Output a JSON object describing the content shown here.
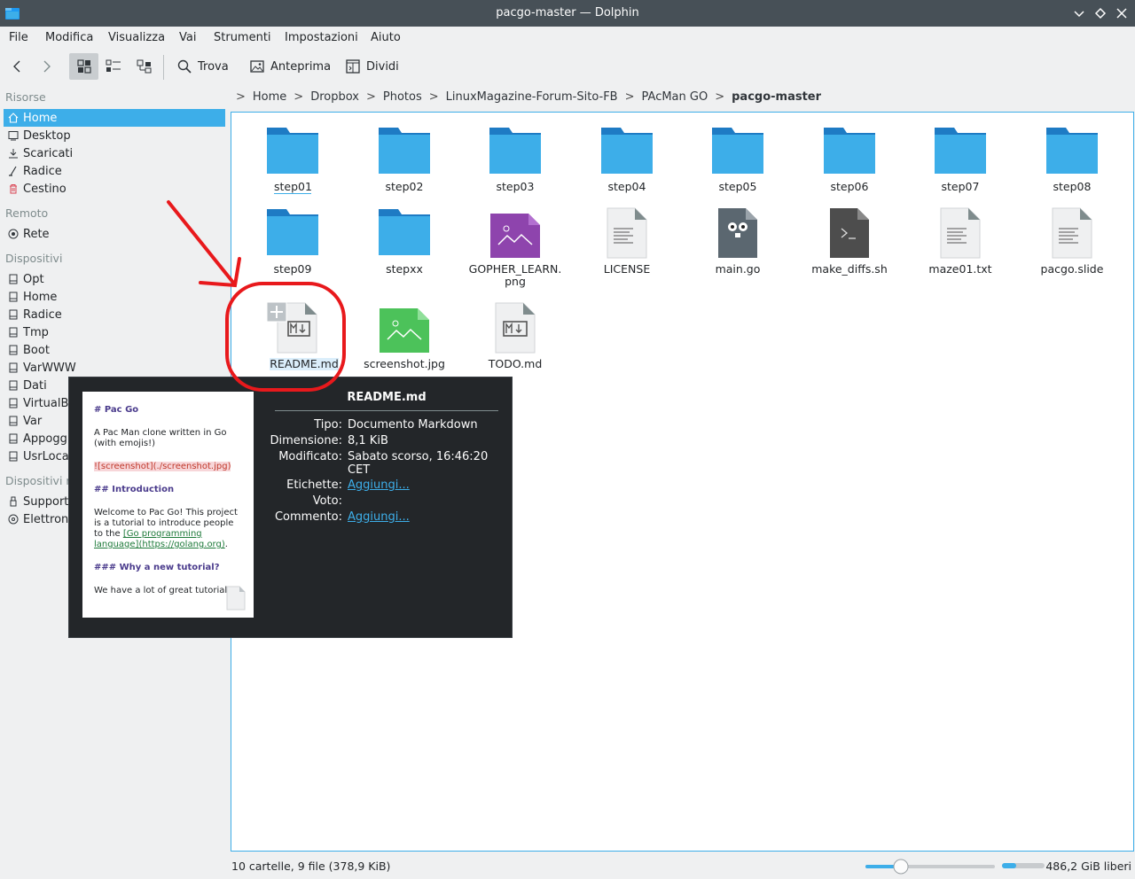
{
  "window": {
    "title": "pacgo-master — Dolphin"
  },
  "menu": [
    "File",
    "Modifica",
    "Visualizza",
    "Vai",
    "Strumenti",
    "Impostazioni",
    "Aiuto"
  ],
  "toolbar": {
    "find": "Trova",
    "preview": "Anteprima",
    "split": "Dividi"
  },
  "sidebar": {
    "sections": [
      {
        "title": "Risorse",
        "items": [
          "Home",
          "Desktop",
          "Scaricati",
          "Radice",
          "Cestino"
        ]
      },
      {
        "title": "Remoto",
        "items": [
          "Rete"
        ]
      },
      {
        "title": "Dispositivi",
        "items": [
          "Opt",
          "Home",
          "Radice",
          "Tmp",
          "Boot",
          "VarWWW",
          "Dati",
          "VirtualBo",
          "Var",
          "Appoggi",
          "UsrLocal"
        ]
      },
      {
        "title": "Dispositivi r",
        "items": [
          "Supporto",
          "Elettroni"
        ]
      }
    ]
  },
  "breadcrumb": [
    "Home",
    "Dropbox",
    "Photos",
    "LinuxMagazine-Forum-Sito-FB",
    "PAcMan GO",
    "pacgo-master"
  ],
  "files": [
    {
      "name": "step01",
      "type": "folder"
    },
    {
      "name": "step02",
      "type": "folder"
    },
    {
      "name": "step03",
      "type": "folder"
    },
    {
      "name": "step04",
      "type": "folder"
    },
    {
      "name": "step05",
      "type": "folder"
    },
    {
      "name": "step06",
      "type": "folder"
    },
    {
      "name": "step07",
      "type": "folder"
    },
    {
      "name": "step08",
      "type": "folder"
    },
    {
      "name": "step09",
      "type": "folder"
    },
    {
      "name": "stepxx",
      "type": "folder"
    },
    {
      "name": "GOPHER_LEARN.",
      "name2": "png",
      "type": "image-purple"
    },
    {
      "name": "LICENSE",
      "type": "text"
    },
    {
      "name": "main.go",
      "type": "go"
    },
    {
      "name": "make_diffs.sh",
      "type": "shell"
    },
    {
      "name": "maze01.txt",
      "type": "text"
    },
    {
      "name": "pacgo.slide",
      "type": "text"
    },
    {
      "name": "README.md",
      "type": "markdown"
    },
    {
      "name": "screenshot.jpg",
      "type": "image-green"
    },
    {
      "name": "TODO.md",
      "type": "markdown"
    }
  ],
  "status": {
    "summary": "10 cartelle, 9 file (378,9 KiB)",
    "free": "486,2 GiB liberi"
  },
  "tooltip": {
    "title": "README.md",
    "rows": [
      {
        "key": "Tipo:",
        "value": "Documento Markdown"
      },
      {
        "key": "Dimensione:",
        "value": "8,1 KiB"
      },
      {
        "key": "Modificato:",
        "value": "Sabato scorso, 16:46:20",
        "value2": "CET"
      },
      {
        "key": "Etichette:",
        "value": "Aggiungi...",
        "link": true
      },
      {
        "key": "Voto:",
        "value": ""
      },
      {
        "key": "Commento:",
        "value": "Aggiungi...",
        "link": true
      }
    ],
    "preview": {
      "h1": "# Pac Go",
      "p1a": "A Pac Man clone written in Go",
      "p1b": "(with emojis!)",
      "img": "![screenshot](./screenshot.jpg)",
      "h2": "## Introduction",
      "p2a": "Welcome to Pac Go! This project",
      "p2b": "is a tutorial to introduce people",
      "p2c": "to the ",
      "p2link1": "[Go programming",
      "p2link2": "language](https://golang.org)",
      "p2d": ".",
      "h3": "### Why a new tutorial?",
      "p3": "We have a lot of great tutorials"
    }
  },
  "colors": {
    "accent": "#3daee9",
    "folder": "#3daee9",
    "annotation": "#e8191c"
  }
}
